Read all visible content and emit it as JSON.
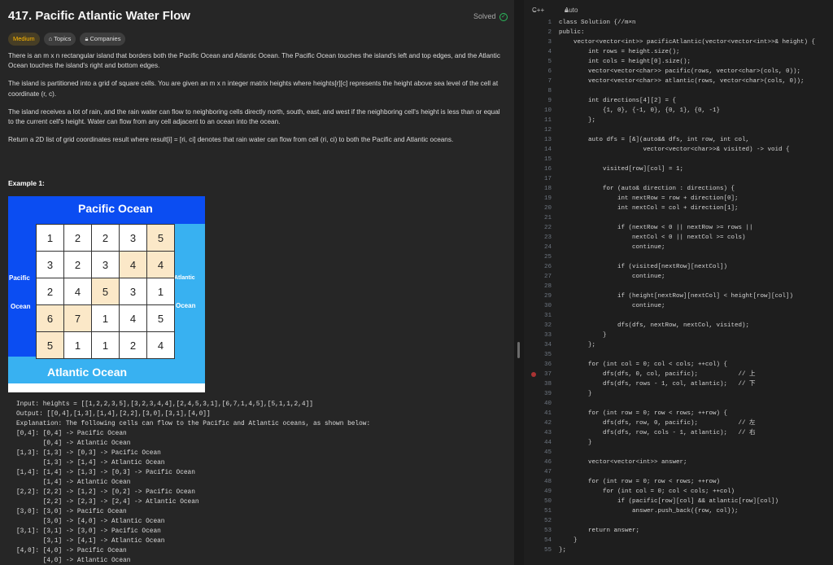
{
  "problem": {
    "title": "417. Pacific Atlantic Water Flow",
    "status": "Solved",
    "difficulty": "Medium",
    "topics_label": "Topics",
    "companies_label": "Companies"
  },
  "description": {
    "p1": "There is an m x n rectangular island that borders both the Pacific Ocean and Atlantic Ocean. The Pacific Ocean touches the island's left and top edges, and the Atlantic Ocean touches the island's right and bottom edges.",
    "p2": "The island is partitioned into a grid of square cells. You are given an m x n integer matrix heights where heights[r][c] represents the height above sea level of the cell at coordinate (r, c).",
    "p3": "The island receives a lot of rain, and the rain water can flow to neighboring cells directly north, south, east, and west if the neighboring cell's height is less than or equal to the current cell's height. Water can flow from any cell adjacent to an ocean into the ocean.",
    "p4": "Return a 2D list of grid coordinates result where result[i] = [ri, ci] denotes that rain water can flow from cell (ri, ci) to both the Pacific and Atlantic oceans."
  },
  "example": {
    "heading": "Example 1:",
    "image": {
      "pacific_top": "Pacific Ocean",
      "pacific_left_1": "Pacific",
      "pacific_left_2": "Ocean",
      "atlantic_right_1": "Atlantic",
      "atlantic_right_2": "Ocean",
      "atlantic_bottom": "Atlantic Ocean",
      "grid": [
        [
          1,
          2,
          2,
          3,
          5
        ],
        [
          3,
          2,
          3,
          4,
          4
        ],
        [
          2,
          4,
          5,
          3,
          1
        ],
        [
          6,
          7,
          1,
          4,
          5
        ],
        [
          5,
          1,
          1,
          2,
          4
        ]
      ],
      "highlighted": [
        [
          0,
          4
        ],
        [
          1,
          3
        ],
        [
          1,
          4
        ],
        [
          2,
          2
        ],
        [
          3,
          0
        ],
        [
          3,
          1
        ],
        [
          4,
          0
        ]
      ],
      "colors": {
        "pacific": "#0b4df2",
        "atlantic": "#38b1f1",
        "highlight": "#fbe8c8"
      }
    },
    "lines": [
      "Input: heights = [[1,2,2,3,5],[3,2,3,4,4],[2,4,5,3,1],[6,7,1,4,5],[5,1,1,2,4]]",
      "Output: [[0,4],[1,3],[1,4],[2,2],[3,0],[3,1],[4,0]]",
      "Explanation: The following cells can flow to the Pacific and Atlantic oceans, as shown below:",
      "[0,4]: [0,4] -> Pacific Ocean",
      "       [0,4] -> Atlantic Ocean",
      "[1,3]: [1,3] -> [0,3] -> Pacific Ocean",
      "       [1,3] -> [1,4] -> Atlantic Ocean",
      "[1,4]: [1,4] -> [1,3] -> [0,3] -> Pacific Ocean",
      "       [1,4] -> Atlantic Ocean",
      "[2,2]: [2,2] -> [1,2] -> [0,2] -> Pacific Ocean",
      "       [2,2] -> [2,3] -> [2,4] -> Atlantic Ocean",
      "[3,0]: [3,0] -> Pacific Ocean",
      "       [3,0] -> [4,0] -> Atlantic Ocean",
      "[3,1]: [3,1] -> [3,0] -> Pacific Ocean",
      "       [3,1] -> [4,1] -> Atlantic Ocean",
      "[4,0]: [4,0] -> Pacific Ocean",
      "       [4,0] -> Atlantic Ocean"
    ]
  },
  "editor": {
    "language": "C++",
    "mode": "Auto",
    "breakpoint_line": 37,
    "lines": [
      "class Solution {//m×n",
      "public:",
      "    vector<vector<int>> pacificAtlantic(vector<vector<int>>& height) {",
      "        int rows = height.size();",
      "        int cols = height[0].size();",
      "        vector<vector<char>> pacific(rows, vector<char>(cols, 0));",
      "        vector<vector<char>> atlantic(rows, vector<char>(cols, 0));",
      "",
      "        int directions[4][2] = {",
      "            {1, 0}, {-1, 0}, {0, 1}, {0, -1}",
      "        };",
      "",
      "        auto dfs = [&](auto&& dfs, int row, int col,",
      "                       vector<vector<char>>& visited) -> void {",
      "",
      "            visited[row][col] = 1;",
      "",
      "            for (auto& direction : directions) {",
      "                int nextRow = row + direction[0];",
      "                int nextCol = col + direction[1];",
      "",
      "                if (nextRow < 0 || nextRow >= rows ||",
      "                    nextCol < 0 || nextCol >= cols)",
      "                    continue;",
      "",
      "                if (visited[nextRow][nextCol])",
      "                    continue;",
      "",
      "                if (height[nextRow][nextCol] < height[row][col])",
      "                    continue;",
      "",
      "                dfs(dfs, nextRow, nextCol, visited);",
      "            }",
      "        };",
      "",
      "        for (int col = 0; col < cols; ++col) {",
      "            dfs(dfs, 0, col, pacific);           // 上",
      "            dfs(dfs, rows - 1, col, atlantic);   // 下",
      "        }",
      "",
      "        for (int row = 0; row < rows; ++row) {",
      "            dfs(dfs, row, 0, pacific);           // 左",
      "            dfs(dfs, row, cols - 1, atlantic);   // 右",
      "        }",
      "",
      "        vector<vector<int>> answer;",
      "",
      "        for (int row = 0; row < rows; ++row)",
      "            for (int col = 0; col < cols; ++col)",
      "                if (pacific[row][col] && atlantic[row][col])",
      "                    answer.push_back({row, col});",
      "",
      "        return answer;",
      "    }",
      "};"
    ]
  }
}
